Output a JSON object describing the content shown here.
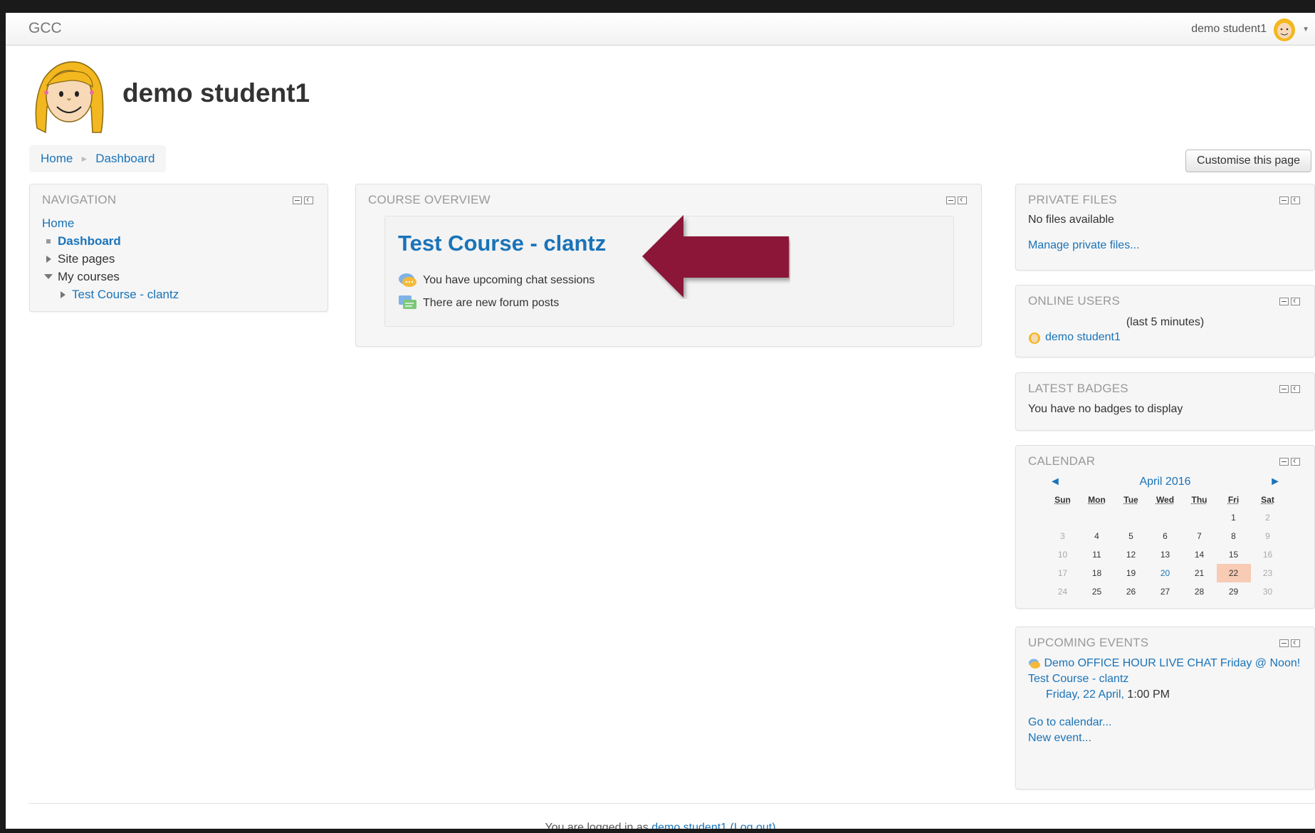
{
  "navbar": {
    "brand": "GCC",
    "user_name": "demo student1"
  },
  "header": {
    "title": "demo student1"
  },
  "breadcrumb": {
    "home": "Home",
    "dashboard": "Dashboard"
  },
  "customise_button": "Customise this page",
  "navigation": {
    "title": "NAVIGATION",
    "home": "Home",
    "dashboard": "Dashboard",
    "site_pages": "Site pages",
    "my_courses": "My courses",
    "course": "Test Course - clantz"
  },
  "course_overview": {
    "title": "COURSE OVERVIEW",
    "course_name": "Test Course - clantz",
    "chat_notice": "You have upcoming chat sessions",
    "forum_notice": "There are new forum posts"
  },
  "private_files": {
    "title": "PRIVATE FILES",
    "empty": "No files available",
    "manage_link": "Manage private files..."
  },
  "online_users": {
    "title": "ONLINE USERS",
    "period": "(last 5 minutes)",
    "user": "demo student1"
  },
  "latest_badges": {
    "title": "LATEST BADGES",
    "empty": "You have no badges to display"
  },
  "calendar": {
    "title": "CALENDAR",
    "month": "April 2016",
    "prev": "◄",
    "next": "►",
    "days": [
      "Sun",
      "Mon",
      "Tue",
      "Wed",
      "Thu",
      "Fri",
      "Sat"
    ],
    "weeks": [
      [
        "",
        "",
        "",
        "",
        "",
        "1",
        "2"
      ],
      [
        "3",
        "4",
        "5",
        "6",
        "7",
        "8",
        "9"
      ],
      [
        "10",
        "11",
        "12",
        "13",
        "14",
        "15",
        "16"
      ],
      [
        "17",
        "18",
        "19",
        "20",
        "21",
        "22",
        "23"
      ],
      [
        "24",
        "25",
        "26",
        "27",
        "28",
        "29",
        "30"
      ]
    ],
    "today": "22",
    "event_day": "20"
  },
  "upcoming_events": {
    "title": "UPCOMING EVENTS",
    "event_name": "Demo OFFICE HOUR LIVE CHAT Friday @ Noon!",
    "event_course": "Test Course - clantz",
    "event_date": "Friday, 22 April,",
    "event_time": "1:00 PM",
    "calendar_link": "Go to calendar...",
    "new_event_link": "New event..."
  },
  "footer": {
    "logged_in_prefix": "You are logged in as",
    "user": "demo student1",
    "logout": "(Log out)"
  },
  "colors": {
    "link": "#1a73b8",
    "arrow": "#8b1538",
    "today_highlight": "#f8cbb5"
  }
}
